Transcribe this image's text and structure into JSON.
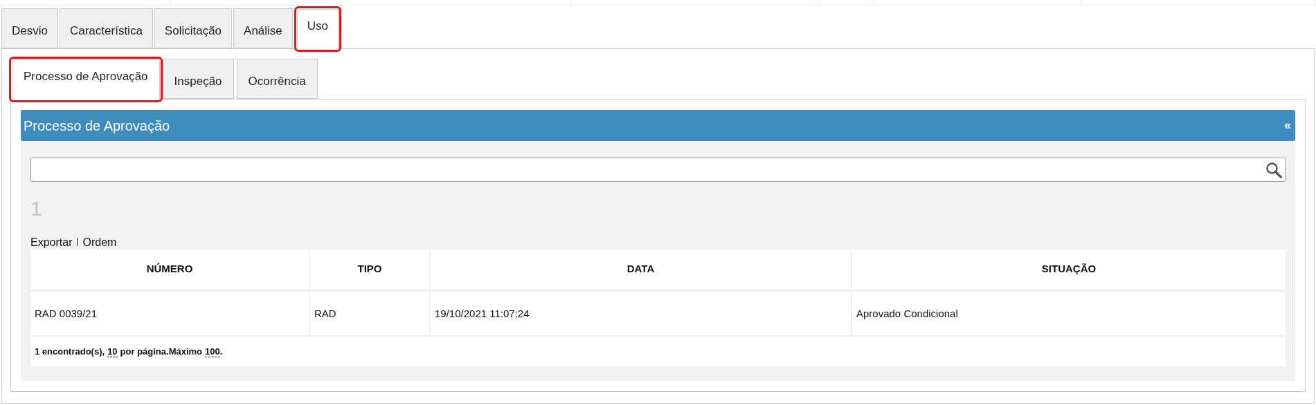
{
  "main_tabs": [
    {
      "label": "Desvio",
      "selected": false,
      "highlighted": false
    },
    {
      "label": "Característica",
      "selected": false,
      "highlighted": false
    },
    {
      "label": "Solicitação",
      "selected": false,
      "highlighted": false
    },
    {
      "label": "Análise",
      "selected": false,
      "highlighted": false
    },
    {
      "label": "Uso",
      "selected": true,
      "highlighted": true
    }
  ],
  "sub_tabs": [
    {
      "label": "Processo de Aprovação",
      "selected": true,
      "highlighted": true
    },
    {
      "label": "Inspeção",
      "selected": false,
      "highlighted": false
    },
    {
      "label": "Ocorrência",
      "selected": false,
      "highlighted": false
    }
  ],
  "panel": {
    "title": "Processo de Aprovação",
    "collapse": "«",
    "page_number": "1",
    "actions": [
      {
        "label": "Exportar"
      },
      {
        "label": "Ordem"
      }
    ],
    "table": {
      "columns": [
        "NÚMERO",
        "TIPO",
        "DATA",
        "SITUAÇÃO"
      ],
      "rows": [
        [
          "RAD 0039/21",
          "RAD",
          "19/10/2021 11:07:24",
          "Aprovado Condicional"
        ]
      ],
      "footer": [
        {
          "kind": "text",
          "text": "1 encontrado(s),"
        },
        {
          "kind": "link",
          "text": "10"
        },
        {
          "kind": "text",
          "text": "por página.Máximo"
        },
        {
          "kind": "link",
          "text": "100"
        },
        {
          "kind": "text",
          "text": "."
        }
      ]
    }
  }
}
